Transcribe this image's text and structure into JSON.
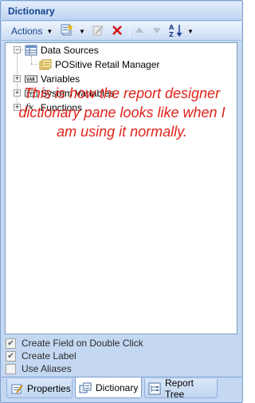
{
  "panel": {
    "title": "Dictionary"
  },
  "toolbar": {
    "actions_label": "Actions",
    "icons": [
      "new-item-icon",
      "edit-icon",
      "delete-icon",
      "move-up-icon",
      "move-down-icon",
      "sort-az-icon"
    ]
  },
  "tree": {
    "items": [
      {
        "label": "Data Sources",
        "icon": "data-sources-icon",
        "expanded": true
      },
      {
        "label": "POSitive Retail Manager",
        "icon": "database-icon"
      },
      {
        "label": "Variables",
        "icon": "variables-icon",
        "expanded": false
      },
      {
        "label": "System Variables",
        "icon": "system-variables-icon",
        "expanded": false
      },
      {
        "label": "Functions",
        "icon": "functions-icon",
        "expanded": false
      }
    ]
  },
  "annotation": {
    "text": "This is how the report designer dictionary pane looks like when I am using it normally."
  },
  "options": {
    "items": [
      {
        "label": "Create Field on Double Click",
        "checked": true
      },
      {
        "label": "Create Label",
        "checked": true
      },
      {
        "label": "Use Aliases",
        "checked": false
      }
    ]
  },
  "tabs": {
    "items": [
      {
        "label": "Properties",
        "icon": "properties-icon",
        "active": false
      },
      {
        "label": "Dictionary",
        "icon": "dictionary-icon",
        "active": true
      },
      {
        "label": "Report Tree",
        "icon": "report-tree-icon",
        "active": false
      }
    ]
  },
  "colors": {
    "panel_bg": "#c4d8f2",
    "title_text": "#15428b",
    "annotation_text": "#e2231a",
    "delete_icon": "#d01010"
  }
}
